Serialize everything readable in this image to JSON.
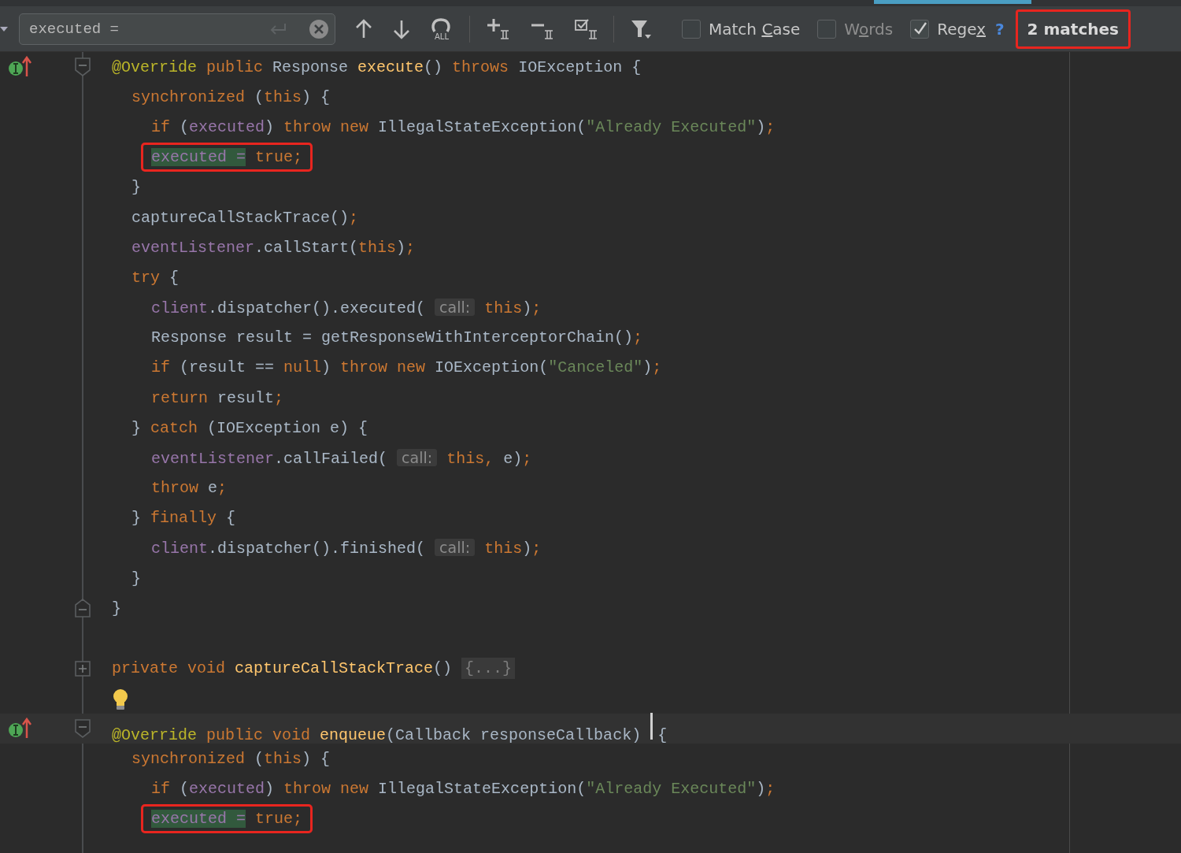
{
  "search": {
    "value": "executed =",
    "tools": [
      {
        "kind": "up"
      },
      {
        "kind": "down"
      },
      {
        "kind": "select-all",
        "label": "ALL"
      },
      {
        "kind": "separator"
      },
      {
        "kind": "add"
      },
      {
        "kind": "remove"
      },
      {
        "kind": "toggle"
      },
      {
        "kind": "separator"
      },
      {
        "kind": "filter"
      }
    ],
    "options": [
      {
        "label": "Match ",
        "mnemonic": "C",
        "label_rest": "ase",
        "checked": false
      },
      {
        "label": "W",
        "mnemonic": "o",
        "label_rest": "rds",
        "checked": false
      },
      {
        "label": "Rege",
        "mnemonic": "x",
        "checked": true
      }
    ],
    "help": "?",
    "matches": "2 matches",
    "matches_boxed": true
  },
  "lines": [
    {
      "marker": true,
      "fold": {
        "kind": "start"
      },
      "current": false,
      "boxed": false,
      "bulb": false,
      "tokens": [
        {
          "t": "@Override",
          "kind": "ann"
        },
        {
          "t": " public",
          "kind": "kw"
        },
        {
          "t": " Response ",
          "kind": "id"
        },
        {
          "t": "execute",
          "kind": "fn"
        },
        {
          "t": "() ",
          "kind": "id"
        },
        {
          "t": "throws",
          "kind": "kw"
        },
        {
          "t": " IOException {",
          "kind": "id"
        }
      ],
      "children": [
        {
          "marker": false,
          "current": false,
          "boxed": false,
          "bulb": false,
          "tokens": [
            {
              "t": "synchronized",
              "kind": "kw"
            },
            {
              "t": " (",
              "kind": "id"
            },
            {
              "t": "this",
              "kind": "kw"
            },
            {
              "t": ") {",
              "kind": "id"
            }
          ],
          "children": [
            {
              "marker": false,
              "current": false,
              "boxed": false,
              "bulb": false,
              "tokens": [
                {
                  "t": "if",
                  "kind": "kw"
                },
                {
                  "t": " (",
                  "kind": "id"
                },
                {
                  "t": "executed",
                  "kind": "field"
                },
                {
                  "t": ") ",
                  "kind": "id"
                },
                {
                  "t": "throw new",
                  "kind": "kw"
                },
                {
                  "t": " IllegalStateException(",
                  "kind": "id"
                },
                {
                  "t": "\"Already Executed\"",
                  "kind": "str"
                },
                {
                  "t": ")",
                  "kind": "id"
                },
                {
                  "t": ";",
                  "kind": "kw"
                }
              ]
            },
            {
              "marker": false,
              "current": false,
              "boxed": true,
              "bulb": false,
              "tokens": [
                {
                  "t": "executed =",
                  "kind": "match"
                },
                {
                  "t": " true;",
                  "kind": "kw"
                }
              ]
            }
          ]
        },
        {
          "marker": false,
          "current": false,
          "boxed": false,
          "bulb": false,
          "tokens": [
            {
              "t": "}",
              "kind": "id"
            }
          ]
        },
        {
          "marker": false,
          "current": false,
          "boxed": false,
          "bulb": false,
          "tokens": [
            {
              "t": "captureCallStackTrace()",
              "kind": "id"
            },
            {
              "t": ";",
              "kind": "kw"
            }
          ]
        },
        {
          "marker": false,
          "current": false,
          "boxed": false,
          "bulb": false,
          "tokens": [
            {
              "t": "eventListener",
              "kind": "field"
            },
            {
              "t": ".callStart(",
              "kind": "id"
            },
            {
              "t": "this",
              "kind": "kw"
            },
            {
              "t": ")",
              "kind": "id"
            },
            {
              "t": ";",
              "kind": "kw"
            }
          ]
        },
        {
          "marker": false,
          "current": false,
          "boxed": false,
          "bulb": false,
          "tokens": [
            {
              "t": "try",
              "kind": "kw"
            },
            {
              "t": " {",
              "kind": "id"
            }
          ],
          "children": [
            {
              "marker": false,
              "current": false,
              "boxed": false,
              "bulb": false,
              "tokens": [
                {
                  "t": "client",
                  "kind": "field"
                },
                {
                  "t": ".dispatcher().executed( ",
                  "kind": "id"
                },
                {
                  "t": "call:",
                  "kind": "hint"
                },
                {
                  "t": " this",
                  "kind": "kw"
                },
                {
                  "t": ")",
                  "kind": "id"
                },
                {
                  "t": ";",
                  "kind": "kw"
                }
              ]
            },
            {
              "marker": false,
              "current": false,
              "boxed": false,
              "bulb": false,
              "tokens": [
                {
                  "t": "Response result = getResponseWithInterceptorChain()",
                  "kind": "id"
                },
                {
                  "t": ";",
                  "kind": "kw"
                }
              ]
            },
            {
              "marker": false,
              "current": false,
              "boxed": false,
              "bulb": false,
              "tokens": [
                {
                  "t": "if",
                  "kind": "kw"
                },
                {
                  "t": " (result == ",
                  "kind": "id"
                },
                {
                  "t": "null",
                  "kind": "kw"
                },
                {
                  "t": ") ",
                  "kind": "id"
                },
                {
                  "t": "throw new",
                  "kind": "kw"
                },
                {
                  "t": " IOException(",
                  "kind": "id"
                },
                {
                  "t": "\"Canceled\"",
                  "kind": "str"
                },
                {
                  "t": ")",
                  "kind": "id"
                },
                {
                  "t": ";",
                  "kind": "kw"
                }
              ]
            },
            {
              "marker": false,
              "current": false,
              "boxed": false,
              "bulb": false,
              "tokens": [
                {
                  "t": "return",
                  "kind": "kw"
                },
                {
                  "t": " result",
                  "kind": "id"
                },
                {
                  "t": ";",
                  "kind": "kw"
                }
              ]
            }
          ]
        },
        {
          "marker": false,
          "current": false,
          "boxed": false,
          "bulb": false,
          "tokens": [
            {
              "t": "} ",
              "kind": "id"
            },
            {
              "t": "catch",
              "kind": "kw"
            },
            {
              "t": " (IOException e) {",
              "kind": "id"
            }
          ],
          "children": [
            {
              "marker": false,
              "current": false,
              "boxed": false,
              "bulb": false,
              "tokens": [
                {
                  "t": "eventListener",
                  "kind": "field"
                },
                {
                  "t": ".callFailed( ",
                  "kind": "id"
                },
                {
                  "t": "call:",
                  "kind": "hint"
                },
                {
                  "t": " this,",
                  "kind": "kw"
                },
                {
                  "t": " e)",
                  "kind": "id"
                },
                {
                  "t": ";",
                  "kind": "kw"
                }
              ]
            },
            {
              "marker": false,
              "current": false,
              "boxed": false,
              "bulb": false,
              "tokens": [
                {
                  "t": "throw",
                  "kind": "kw"
                },
                {
                  "t": " e",
                  "kind": "id"
                },
                {
                  "t": ";",
                  "kind": "kw"
                }
              ]
            }
          ]
        },
        {
          "marker": false,
          "current": false,
          "boxed": false,
          "bulb": false,
          "tokens": [
            {
              "t": "} ",
              "kind": "id"
            },
            {
              "t": "finally",
              "kind": "kw"
            },
            {
              "t": " {",
              "kind": "id"
            }
          ],
          "children": [
            {
              "marker": false,
              "current": false,
              "boxed": false,
              "bulb": false,
              "tokens": [
                {
                  "t": "client",
                  "kind": "field"
                },
                {
                  "t": ".dispatcher().finished( ",
                  "kind": "id"
                },
                {
                  "t": "call:",
                  "kind": "hint"
                },
                {
                  "t": " this",
                  "kind": "kw"
                },
                {
                  "t": ")",
                  "kind": "id"
                },
                {
                  "t": ";",
                  "kind": "kw"
                }
              ]
            }
          ]
        },
        {
          "marker": false,
          "current": false,
          "boxed": false,
          "bulb": false,
          "tokens": [
            {
              "t": "}",
              "kind": "id"
            }
          ]
        }
      ]
    },
    {
      "marker": false,
      "fold": {
        "kind": "end"
      },
      "current": false,
      "boxed": false,
      "bulb": false,
      "tokens": [
        {
          "t": "}",
          "kind": "id"
        }
      ]
    },
    {
      "marker": false,
      "current": false,
      "boxed": false,
      "bulb": false
    },
    {
      "marker": false,
      "fold": {
        "kind": "collapsed"
      },
      "current": false,
      "boxed": false,
      "bulb": false,
      "tokens": [
        {
          "t": "private void",
          "kind": "kw"
        },
        {
          "t": " captureCallStackTrace",
          "kind": "fn"
        },
        {
          "t": "() ",
          "kind": "id"
        },
        {
          "t": "{...}",
          "kind": "folded"
        }
      ]
    },
    {
      "marker": false,
      "current": false,
      "boxed": false,
      "bulb": true
    },
    {
      "marker": true,
      "fold": {
        "kind": "start"
      },
      "current": true,
      "boxed": false,
      "bulb": false,
      "tokens": [
        {
          "t": "@Override",
          "kind": "ann"
        },
        {
          "t": " public void",
          "kind": "kw"
        },
        {
          "t": " enqueue",
          "kind": "fn"
        },
        {
          "t": "(Callback responseCallback) ",
          "kind": "id"
        },
        {
          "kind": "caret"
        },
        {
          "t": "{",
          "kind": "id"
        }
      ],
      "children": [
        {
          "marker": false,
          "current": false,
          "boxed": false,
          "bulb": false,
          "tokens": [
            {
              "t": "synchronized",
              "kind": "kw"
            },
            {
              "t": " (",
              "kind": "id"
            },
            {
              "t": "this",
              "kind": "kw"
            },
            {
              "t": ") {",
              "kind": "id"
            }
          ],
          "children": [
            {
              "marker": false,
              "current": false,
              "boxed": false,
              "bulb": false,
              "tokens": [
                {
                  "t": "if",
                  "kind": "kw"
                },
                {
                  "t": " (",
                  "kind": "id"
                },
                {
                  "t": "executed",
                  "kind": "field"
                },
                {
                  "t": ") ",
                  "kind": "id"
                },
                {
                  "t": "throw new",
                  "kind": "kw"
                },
                {
                  "t": " IllegalStateException(",
                  "kind": "id"
                },
                {
                  "t": "\"Already Executed\"",
                  "kind": "str"
                },
                {
                  "t": ")",
                  "kind": "id"
                },
                {
                  "t": ";",
                  "kind": "kw"
                }
              ]
            },
            {
              "marker": false,
              "current": false,
              "boxed": true,
              "bulb": false,
              "tokens": [
                {
                  "t": "executed =",
                  "kind": "match"
                },
                {
                  "t": " true;",
                  "kind": "kw"
                }
              ]
            }
          ]
        }
      ]
    }
  ]
}
